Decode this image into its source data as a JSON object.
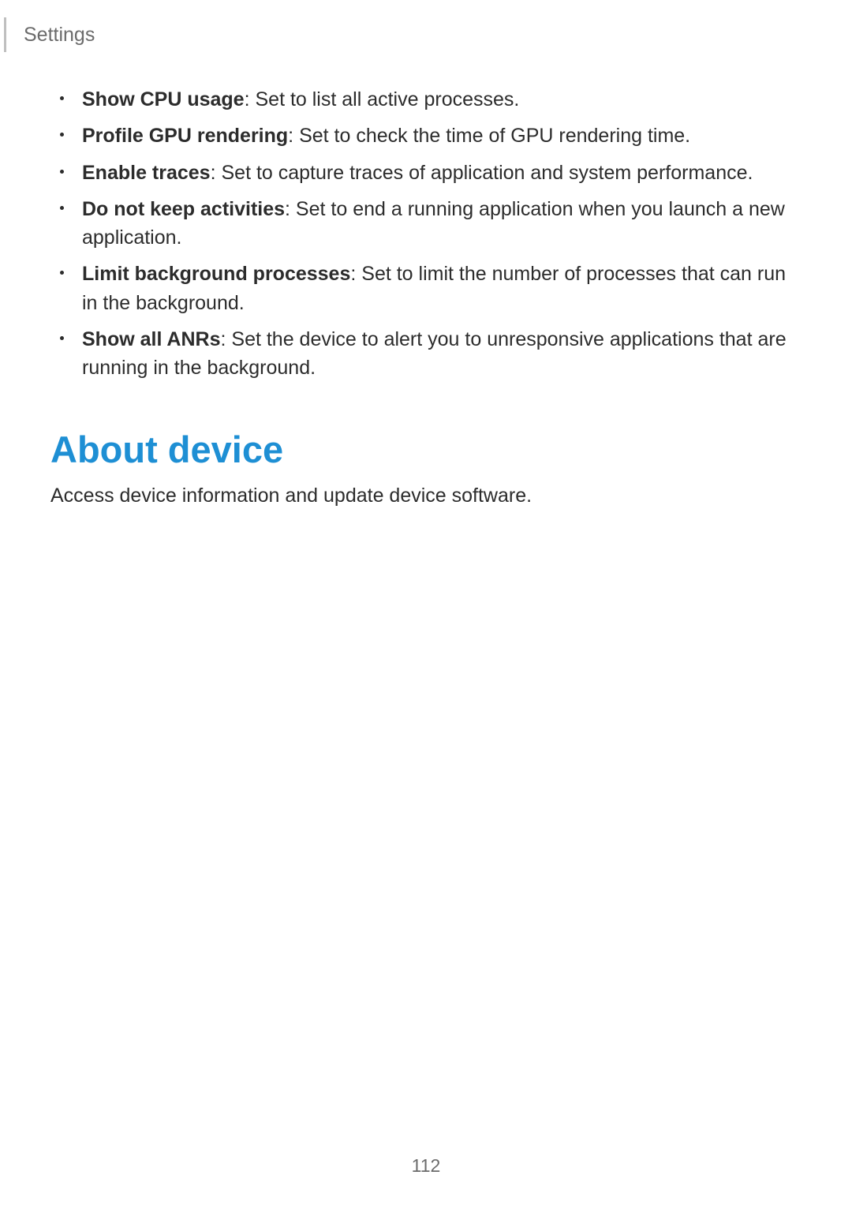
{
  "header": {
    "title": "Settings"
  },
  "bullets": [
    {
      "term": "Show CPU usage",
      "desc": ": Set to list all active processes."
    },
    {
      "term": "Profile GPU rendering",
      "desc": ": Set to check the time of GPU rendering time."
    },
    {
      "term": "Enable traces",
      "desc": ": Set to capture traces of application and system performance."
    },
    {
      "term": "Do not keep activities",
      "desc": ": Set to end a running application when you launch a new application."
    },
    {
      "term": "Limit background processes",
      "desc": ": Set to limit the number of processes that can run in the background."
    },
    {
      "term": "Show all ANRs",
      "desc": ": Set the device to alert you to unresponsive applications that are running in the background."
    }
  ],
  "section": {
    "title": "About device",
    "desc": "Access device information and update device software."
  },
  "page_number": "112"
}
